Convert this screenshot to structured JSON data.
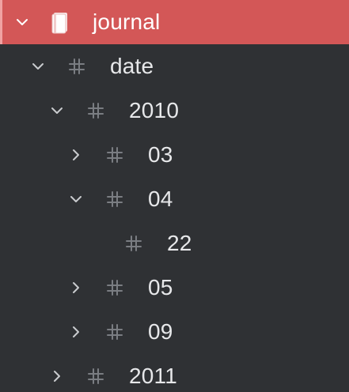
{
  "colors": {
    "background": "#2f3134",
    "selected_row": "#d35757",
    "text": "#e7e8ea",
    "tag_icon": "#7a7d82",
    "chevron": "#c9cbce"
  },
  "tree": {
    "root": {
      "label": "journal",
      "icon": "notebook-icon",
      "expanded": true,
      "selected": true
    },
    "nodes": [
      {
        "label": "date",
        "icon": "tag-icon",
        "expanded": true
      },
      {
        "label": "2010",
        "icon": "tag-icon",
        "expanded": true
      },
      {
        "label": "03",
        "icon": "tag-icon",
        "expanded": false
      },
      {
        "label": "04",
        "icon": "tag-icon",
        "expanded": true
      },
      {
        "label": "22",
        "icon": "tag-icon",
        "expanded": null
      },
      {
        "label": "05",
        "icon": "tag-icon",
        "expanded": false
      },
      {
        "label": "09",
        "icon": "tag-icon",
        "expanded": false
      },
      {
        "label": "2011",
        "icon": "tag-icon",
        "expanded": false
      }
    ]
  }
}
